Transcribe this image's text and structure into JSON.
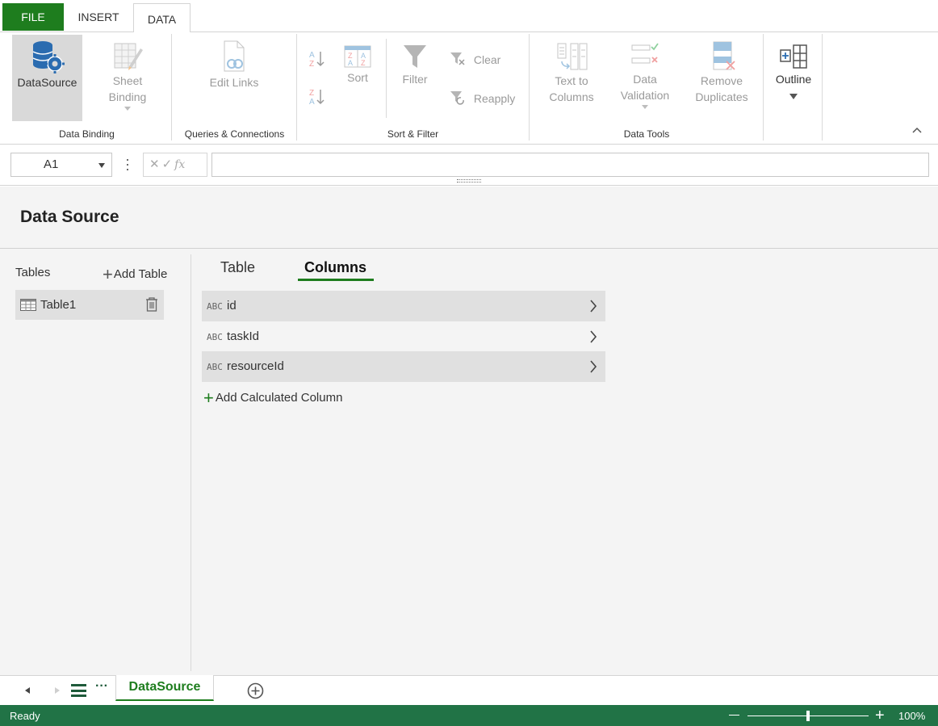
{
  "ribbon_tabs": {
    "file": "FILE",
    "insert": "INSERT",
    "data": "DATA"
  },
  "ribbon": {
    "data_binding": {
      "label": "Data Binding",
      "datasource": "DataSource",
      "sheet_binding_1": "Sheet",
      "sheet_binding_2": "Binding"
    },
    "queries": {
      "label": "Queries & Connections",
      "edit_links": "Edit Links"
    },
    "sort_filter": {
      "label": "Sort & Filter",
      "sort": "Sort",
      "filter": "Filter",
      "clear": "Clear",
      "reapply": "Reapply"
    },
    "data_tools": {
      "label": "Data Tools",
      "text_to_columns_1": "Text to",
      "text_to_columns_2": "Columns",
      "data_validation_1": "Data",
      "data_validation_2": "Validation",
      "remove_duplicates_1": "Remove",
      "remove_duplicates_2": "Duplicates"
    },
    "outline": "Outline"
  },
  "formula_bar": {
    "cell_ref": "A1",
    "formula": ""
  },
  "panel": {
    "title": "Data Source",
    "tables_label": "Tables",
    "add_table": "Add Table",
    "tables": [
      {
        "name": "Table1"
      }
    ],
    "tabs": {
      "table": "Table",
      "columns": "Columns"
    },
    "columns": [
      {
        "type": "ABC",
        "name": "id"
      },
      {
        "type": "ABC",
        "name": "taskId"
      },
      {
        "type": "ABC",
        "name": "resourceId"
      }
    ],
    "add_calculated_column": "Add Calculated Column"
  },
  "sheets": {
    "active": "DataSource"
  },
  "status": {
    "text": "Ready",
    "zoom": "100%",
    "zoom_level": 0.5
  },
  "colors": {
    "accent": "#1e7d1e",
    "status_bar": "#217346"
  }
}
